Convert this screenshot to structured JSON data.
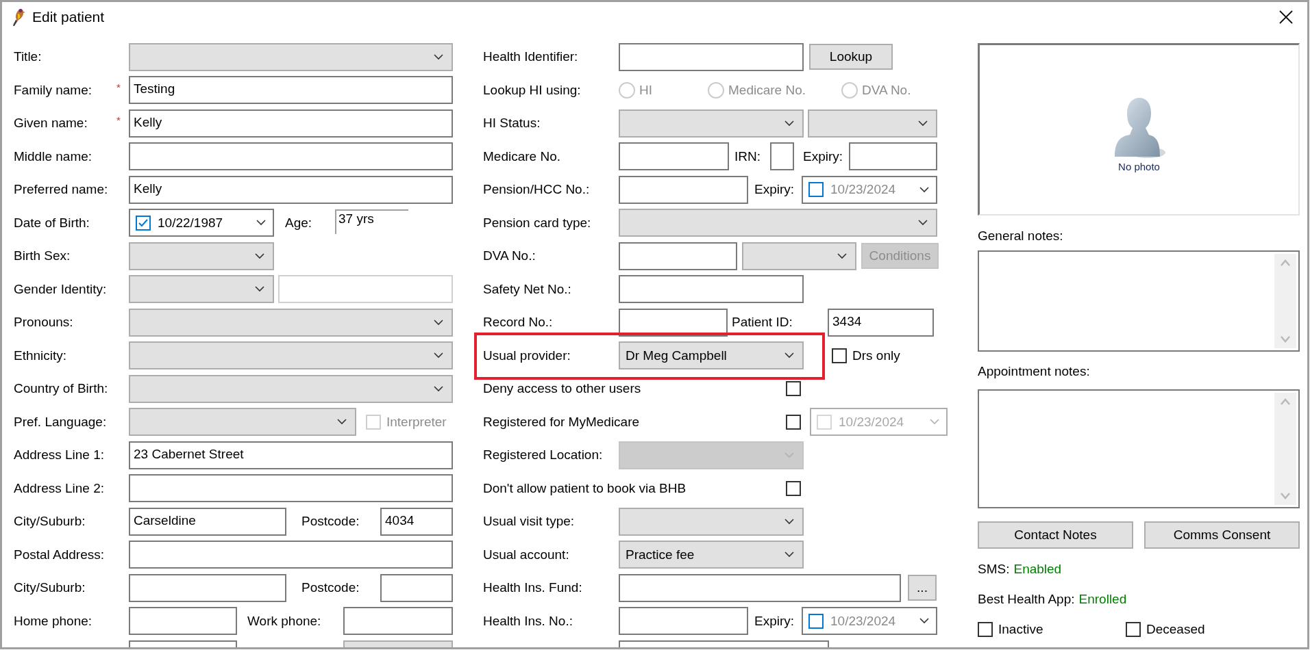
{
  "window": {
    "title": "Edit patient"
  },
  "left_rows": [
    {
      "label": "Title:",
      "controls": [
        {
          "kind": "combo"
        }
      ]
    },
    {
      "label": "Family name:",
      "marker": "*",
      "controls": [
        {
          "kind": "input",
          "value": "Testing"
        }
      ]
    },
    {
      "label": "Given name:",
      "marker": "*",
      "controls": [
        {
          "kind": "input",
          "value": "Kelly"
        }
      ]
    },
    {
      "label": "Middle name:",
      "controls": [
        {
          "kind": "input"
        }
      ]
    },
    {
      "label": "Preferred name:",
      "controls": [
        {
          "kind": "input",
          "value": "Kelly"
        }
      ]
    },
    {
      "label": "Date of Birth:",
      "controls": [
        {
          "kind": "date",
          "checked": true,
          "disabled": false,
          "value": "10/22/1987"
        },
        {
          "kind": "text",
          "text": "Age:"
        },
        {
          "kind": "readout",
          "value": "37 yrs"
        }
      ]
    },
    {
      "label": "Birth Sex:",
      "controls": [
        {
          "kind": "combo"
        }
      ]
    },
    {
      "label": "Gender Identity:",
      "controls": [
        {
          "kind": "combo"
        },
        {
          "kind": "input",
          "disabled": true
        }
      ]
    },
    {
      "label": "Pronouns:",
      "controls": [
        {
          "kind": "combo"
        }
      ]
    },
    {
      "label": "Ethnicity:",
      "controls": [
        {
          "kind": "combo"
        }
      ]
    },
    {
      "label": "Country of Birth:",
      "controls": [
        {
          "kind": "combo"
        }
      ]
    },
    {
      "label": "Pref. Language:",
      "controls": [
        {
          "kind": "combo"
        },
        {
          "kind": "checkbox",
          "text": "Interpreter",
          "checked": false,
          "disabled": true
        }
      ]
    },
    {
      "label": "Address Line 1:",
      "controls": [
        {
          "kind": "input",
          "value": "23 Cabernet Street"
        }
      ]
    },
    {
      "label": "Address Line 2:",
      "controls": [
        {
          "kind": "input"
        }
      ]
    },
    {
      "label": "City/Suburb:",
      "controls": [
        {
          "kind": "input",
          "value": "Carseldine"
        },
        {
          "kind": "text",
          "text": "Postcode:"
        },
        {
          "kind": "input",
          "value": "4034"
        }
      ]
    },
    {
      "label": "Postal Address:",
      "controls": [
        {
          "kind": "input"
        }
      ]
    },
    {
      "label": "City/Suburb:",
      "controls": [
        {
          "kind": "input"
        },
        {
          "kind": "text",
          "text": "Postcode:"
        },
        {
          "kind": "input"
        }
      ]
    },
    {
      "label": "Home phone:",
      "controls": [
        {
          "kind": "input"
        },
        {
          "kind": "text",
          "text": "Work phone:"
        },
        {
          "kind": "input"
        }
      ]
    },
    {
      "controls": [
        {
          "kind": "input"
        },
        {
          "kind": "strip"
        }
      ]
    }
  ],
  "middle_rows": [
    {
      "kind": "field",
      "label": "Health Identifier:",
      "controls": [
        {
          "kind": "input"
        },
        {
          "kind": "button",
          "text": "Lookup",
          "disabled": false
        }
      ]
    },
    {
      "kind": "field",
      "label": "Lookup HI using:",
      "controls": [
        {
          "kind": "radio",
          "text": "HI",
          "selected": false,
          "disabled": true
        },
        {
          "kind": "radio",
          "text": "Medicare No.",
          "selected": false,
          "disabled": true
        },
        {
          "kind": "radio",
          "text": "DVA No.",
          "selected": false,
          "disabled": true
        }
      ]
    },
    {
      "kind": "field",
      "label": "HI Status:",
      "controls": [
        {
          "kind": "combo"
        },
        {
          "kind": "combo"
        }
      ]
    },
    {
      "kind": "field",
      "label": "Medicare No.",
      "controls": [
        {
          "kind": "input"
        },
        {
          "kind": "text",
          "text": "IRN:"
        },
        {
          "kind": "input"
        },
        {
          "kind": "text",
          "text": "Expiry:"
        },
        {
          "kind": "input"
        }
      ]
    },
    {
      "kind": "field",
      "label": "Pension/HCC No.:",
      "controls": [
        {
          "kind": "input"
        },
        {
          "kind": "text",
          "text": "Expiry:"
        },
        {
          "kind": "date",
          "checked": false,
          "disabled": false,
          "value": "10/23/2024"
        }
      ]
    },
    {
      "kind": "field",
      "label": "Pension card type:",
      "controls": [
        {
          "kind": "combo"
        }
      ]
    },
    {
      "kind": "field",
      "label": "DVA No.:",
      "controls": [
        {
          "kind": "input"
        },
        {
          "kind": "combo"
        },
        {
          "kind": "button",
          "text": "Conditions",
          "disabled": true
        }
      ]
    },
    {
      "kind": "field",
      "label": "Safety Net No.:",
      "controls": [
        {
          "kind": "input"
        }
      ]
    },
    {
      "kind": "field",
      "label": "Record No.:",
      "controls": [
        {
          "kind": "input"
        },
        {
          "kind": "text",
          "text": "Patient ID:"
        },
        {
          "kind": "input",
          "value": "3434"
        }
      ]
    },
    {
      "kind": "field",
      "label": "Usual provider:",
      "highlighted": true,
      "controls": [
        {
          "kind": "combo",
          "value": "Dr Meg Campbell"
        },
        {
          "kind": "checkbox",
          "text": "Drs only",
          "checked": false,
          "disabled": false
        }
      ]
    },
    {
      "kind": "check",
      "label": "Deny access to other users",
      "controls": [
        {
          "kind": "checkbox",
          "checked": false,
          "disabled": false
        }
      ]
    },
    {
      "kind": "check",
      "label": "Registered for MyMedicare",
      "controls": [
        {
          "kind": "checkbox",
          "checked": false,
          "disabled": false
        },
        {
          "kind": "date",
          "checked": false,
          "disabled": true,
          "value": "10/23/2024"
        }
      ]
    },
    {
      "kind": "field",
      "label": "Registered Location:",
      "controls": [
        {
          "kind": "combo",
          "disabled": true
        }
      ]
    },
    {
      "kind": "check",
      "label": "Don't allow patient to book via BHB",
      "controls": [
        {
          "kind": "checkbox",
          "checked": false,
          "disabled": false
        }
      ]
    },
    {
      "kind": "field",
      "label": "Usual visit type:",
      "controls": [
        {
          "kind": "combo"
        }
      ]
    },
    {
      "kind": "field",
      "label": "Usual account:",
      "controls": [
        {
          "kind": "combo",
          "value": "Practice fee"
        }
      ]
    },
    {
      "kind": "field",
      "label": "Health Ins. Fund:",
      "controls": [
        {
          "kind": "input"
        },
        {
          "kind": "button",
          "text": "...",
          "disabled": false
        }
      ]
    },
    {
      "kind": "field",
      "label": "Health Ins. No.:",
      "controls": [
        {
          "kind": "input"
        },
        {
          "kind": "text",
          "text": "Expiry:"
        },
        {
          "kind": "date",
          "checked": false,
          "disabled": false,
          "value": "10/23/2024"
        }
      ]
    },
    {
      "kind": "field",
      "controls": [
        {
          "kind": "input"
        }
      ]
    }
  ],
  "photo": {
    "caption": "No photo"
  },
  "general_notes": {
    "label": "General notes:"
  },
  "appointment_notes": {
    "label": "Appointment notes:"
  },
  "buttons": [
    {
      "text": "Contact Notes"
    },
    {
      "text": "Comms Consent"
    }
  ],
  "statuses": [
    {
      "label": "SMS:",
      "value": "Enabled",
      "color": "#008000"
    },
    {
      "label": "Best Health App:",
      "value": "Enrolled",
      "color": "#008000"
    }
  ],
  "flags": [
    {
      "label": "Inactive",
      "checked": false
    },
    {
      "label": "Deceased",
      "checked": false
    }
  ]
}
